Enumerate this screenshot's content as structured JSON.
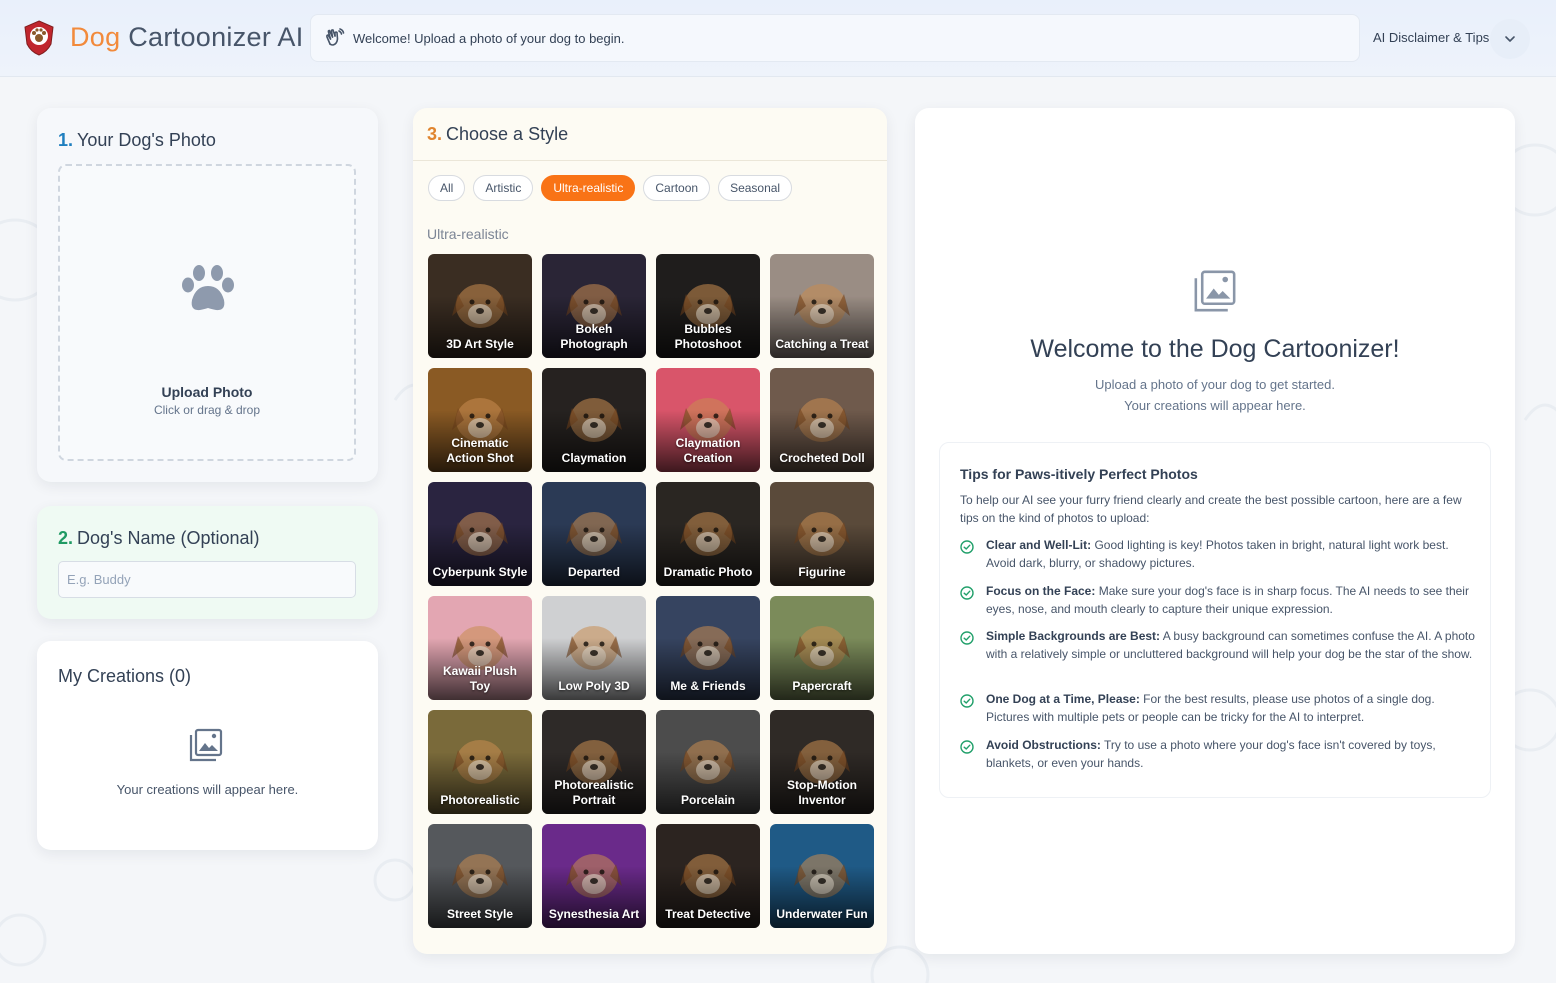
{
  "header": {
    "brand_part1": "Dog",
    "brand_part2": "Cartoonizer AI",
    "status_message": "Welcome! Upload a photo of your dog to begin.",
    "disclaimer_label": "AI Disclaimer & Tips"
  },
  "photo_panel": {
    "step": "1.",
    "title": "Your Dog's Photo",
    "upload_label": "Upload Photo",
    "upload_hint": "Click or drag & drop"
  },
  "name_panel": {
    "step": "2.",
    "title": "Dog's Name (Optional)",
    "placeholder": "E.g. Buddy"
  },
  "creations_panel": {
    "title": "My Creations (0)",
    "empty_text": "Your creations will appear here."
  },
  "style_panel": {
    "step": "3.",
    "title": "Choose a Style",
    "filters": [
      "All",
      "Artistic",
      "Ultra-realistic",
      "Cartoon",
      "Seasonal"
    ],
    "active_filter": "Ultra-realistic",
    "section_label": "Ultra-realistic",
    "styles": [
      {
        "label": "3D Art Style",
        "bg": "#3a2d22"
      },
      {
        "label": "Bokeh Photograph",
        "bg": "#2a2536"
      },
      {
        "label": "Bubbles Photoshoot",
        "bg": "#1f1d1c"
      },
      {
        "label": "Catching a Treat",
        "bg": "#9a8d84"
      },
      {
        "label": "Cinematic Action Shot",
        "bg": "#8a5a24"
      },
      {
        "label": "Claymation",
        "bg": "#262220"
      },
      {
        "label": "Claymation Creation",
        "bg": "#d9556a"
      },
      {
        "label": "Crocheted Doll",
        "bg": "#6f5a4c"
      },
      {
        "label": "Cyberpunk Style",
        "bg": "#2a2440"
      },
      {
        "label": "Departed",
        "bg": "#2b3a55"
      },
      {
        "label": "Dramatic Photo",
        "bg": "#2a2622"
      },
      {
        "label": "Figurine",
        "bg": "#5a4a3a"
      },
      {
        "label": "Kawaii Plush Toy",
        "bg": "#e3a6b2"
      },
      {
        "label": "Low Poly 3D",
        "bg": "#cfd0d2"
      },
      {
        "label": "Me & Friends",
        "bg": "#364460"
      },
      {
        "label": "Papercraft",
        "bg": "#7b8b5a"
      },
      {
        "label": "Photorealistic",
        "bg": "#7a6a3a"
      },
      {
        "label": "Photorealistic Portrait",
        "bg": "#2e2a28"
      },
      {
        "label": "Porcelain",
        "bg": "#4c4c4c"
      },
      {
        "label": "Stop-Motion Inventor",
        "bg": "#2f2a26"
      },
      {
        "label": "Street Style",
        "bg": "#55585c"
      },
      {
        "label": "Synesthesia Art",
        "bg": "#6a2a8a"
      },
      {
        "label": "Treat Detective",
        "bg": "#2c2420"
      },
      {
        "label": "Underwater Fun",
        "bg": "#1f5a86"
      }
    ]
  },
  "welcome_panel": {
    "title": "Welcome to the Dog Cartoonizer!",
    "subtitle_line1": "Upload a photo of your dog to get started.",
    "subtitle_line2": "Your creations will appear here.",
    "tips_title": "Tips for Paws-itively Perfect Photos",
    "tips_intro": "To help our AI see your furry friend clearly and create the best possible cartoon, here are a few tips on the kind of photos to upload:",
    "tips": [
      {
        "bold": "Clear and Well-Lit:",
        "text": "Good lighting is key! Photos taken in bright, natural light work best. Avoid dark, blurry, or shadowy pictures."
      },
      {
        "bold": "Focus on the Face:",
        "text": "Make sure your dog's face is in sharp focus. The AI needs to see their eyes, nose, and mouth clearly to capture their unique expression."
      },
      {
        "bold": "Simple Backgrounds are Best:",
        "text": "A busy background can sometimes confuse the AI. A photo with a relatively simple or uncluttered background will help your dog be the star of the show."
      },
      {
        "bold": "One Dog at a Time, Please:",
        "text": "For the best results, please use photos of a single dog. Pictures with multiple pets or people can be tricky for the AI to interpret."
      },
      {
        "bold": "Avoid Obstructions:",
        "text": "Try to use a photo where your dog's face isn't covered by toys, blankets, or even your hands."
      }
    ]
  },
  "colors": {
    "accent_orange": "#f97316",
    "step1_blue": "#1f7fbf",
    "step2_green": "#1f9a63",
    "step3_orange": "#e0852f",
    "check_green": "#22a06b"
  },
  "icons": {
    "logo": "dog-badge-logo",
    "status": "wave-hand-icon",
    "disclaimer": "chevron-down-icon",
    "upload": "paw-icon",
    "gallery": "image-gallery-icon",
    "tip": "check-circle-icon"
  }
}
